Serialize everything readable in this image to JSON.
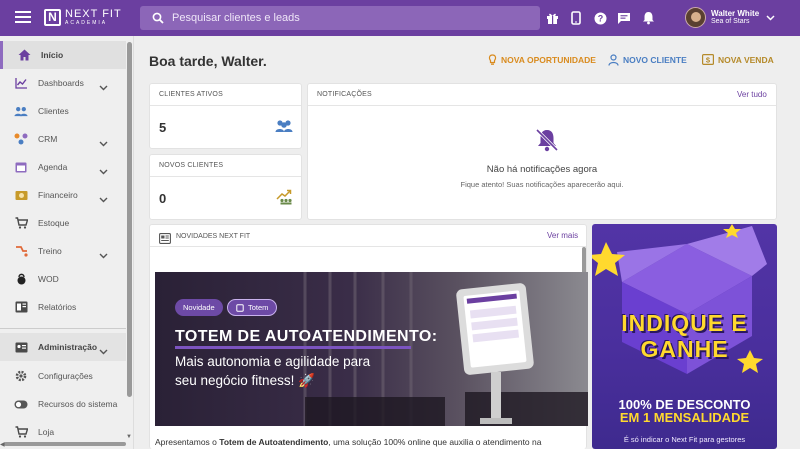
{
  "brand": {
    "name": "NEXT FIT",
    "sub": "ACADEMIA"
  },
  "search": {
    "placeholder": "Pesquisar clientes e leads"
  },
  "user": {
    "name": "Walter White",
    "org": "Sea of Stars"
  },
  "top_icons": [
    "gift-icon",
    "mobile-icon",
    "help-icon",
    "chat-icon",
    "bell-icon"
  ],
  "sidebar": {
    "items": [
      {
        "label": "Início",
        "icon": "home-icon"
      },
      {
        "label": "Dashboards",
        "icon": "chart-line-icon"
      },
      {
        "label": "Clientes",
        "icon": "people-icon"
      },
      {
        "label": "CRM",
        "icon": "crm-icon"
      },
      {
        "label": "Agenda",
        "icon": "calendar-icon"
      },
      {
        "label": "Financeiro",
        "icon": "money-icon"
      },
      {
        "label": "Estoque",
        "icon": "cart-icon"
      },
      {
        "label": "Treino",
        "icon": "workout-icon"
      },
      {
        "label": "WOD",
        "icon": "kettlebell-icon"
      },
      {
        "label": "Relatórios",
        "icon": "report-icon"
      },
      {
        "label": "Administração",
        "icon": "admin-card-icon"
      },
      {
        "label": "Configurações",
        "icon": "gear-icon"
      },
      {
        "label": "Recursos do sistema",
        "icon": "toggle-icon"
      },
      {
        "label": "Loja",
        "icon": "cart-icon"
      }
    ]
  },
  "greeting": "Boa tarde, Walter.",
  "actions": {
    "opportunity": "NOVA OPORTUNIDADE",
    "client": "NOVO CLIENTE",
    "sale": "NOVA VENDA"
  },
  "colors": {
    "primary": "#6b3fa0",
    "opportunity": "#d98b1e",
    "client": "#4a7ec2",
    "sale": "#b58a2a"
  },
  "active_clients": {
    "title": "CLIENTES ATIVOS",
    "value": "5"
  },
  "new_clients": {
    "title": "NOVOS CLIENTES",
    "value": "0"
  },
  "notifications": {
    "title": "NOTIFICAÇÕES",
    "see_all": "Ver tudo",
    "empty_title": "Não há notificações agora",
    "empty_sub": "Fique atento! Suas notificações aparecerão aqui."
  },
  "news": {
    "title": "NOVIDADES NEXT FIT",
    "see_more": "Ver mais",
    "chips": [
      "Novidade",
      "Totem"
    ],
    "banner_title": "TOTEM DE AUTOATENDIMENTO:",
    "banner_line1": "Mais autonomia e agilidade para",
    "banner_line2": "seu negócio fitness! 🚀",
    "text_pre": "Apresentamos o ",
    "text_bold": "Totem de Autoatendimento",
    "text_post": ", uma solução 100% online que auxilia o atendimento na"
  },
  "promo": {
    "line1": "INDIQUE E",
    "line2": "GANHE",
    "discount1": "100% DE DESCONTO",
    "discount2": "EM 1 MENSALIDADE",
    "footer": "É só indicar o Next Fit para gestores"
  }
}
